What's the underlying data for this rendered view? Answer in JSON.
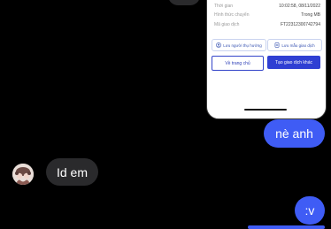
{
  "receipt": {
    "rows": [
      {
        "label": "Thời gian",
        "value": "10:02:58, 08/11/2022"
      },
      {
        "label": "Hình thức chuyển",
        "value": "Trong MB"
      },
      {
        "label": "Mã giao dịch",
        "value": "FT22312300742794"
      }
    ],
    "save_recipient": "Lưu người thụ hưởng",
    "save_template": "Lưu mẫu giao dịch",
    "home_button": "Về trang chủ",
    "new_transaction_button": "Tạo giao dịch khác"
  },
  "messages": {
    "outgoing_1": "nè anh",
    "incoming_1": "Id em",
    "outgoing_2": ":v"
  },
  "colors": {
    "outgoing_bubble": "#3f5cf5",
    "incoming_bubble": "#2a2a2c",
    "background": "#000000"
  }
}
